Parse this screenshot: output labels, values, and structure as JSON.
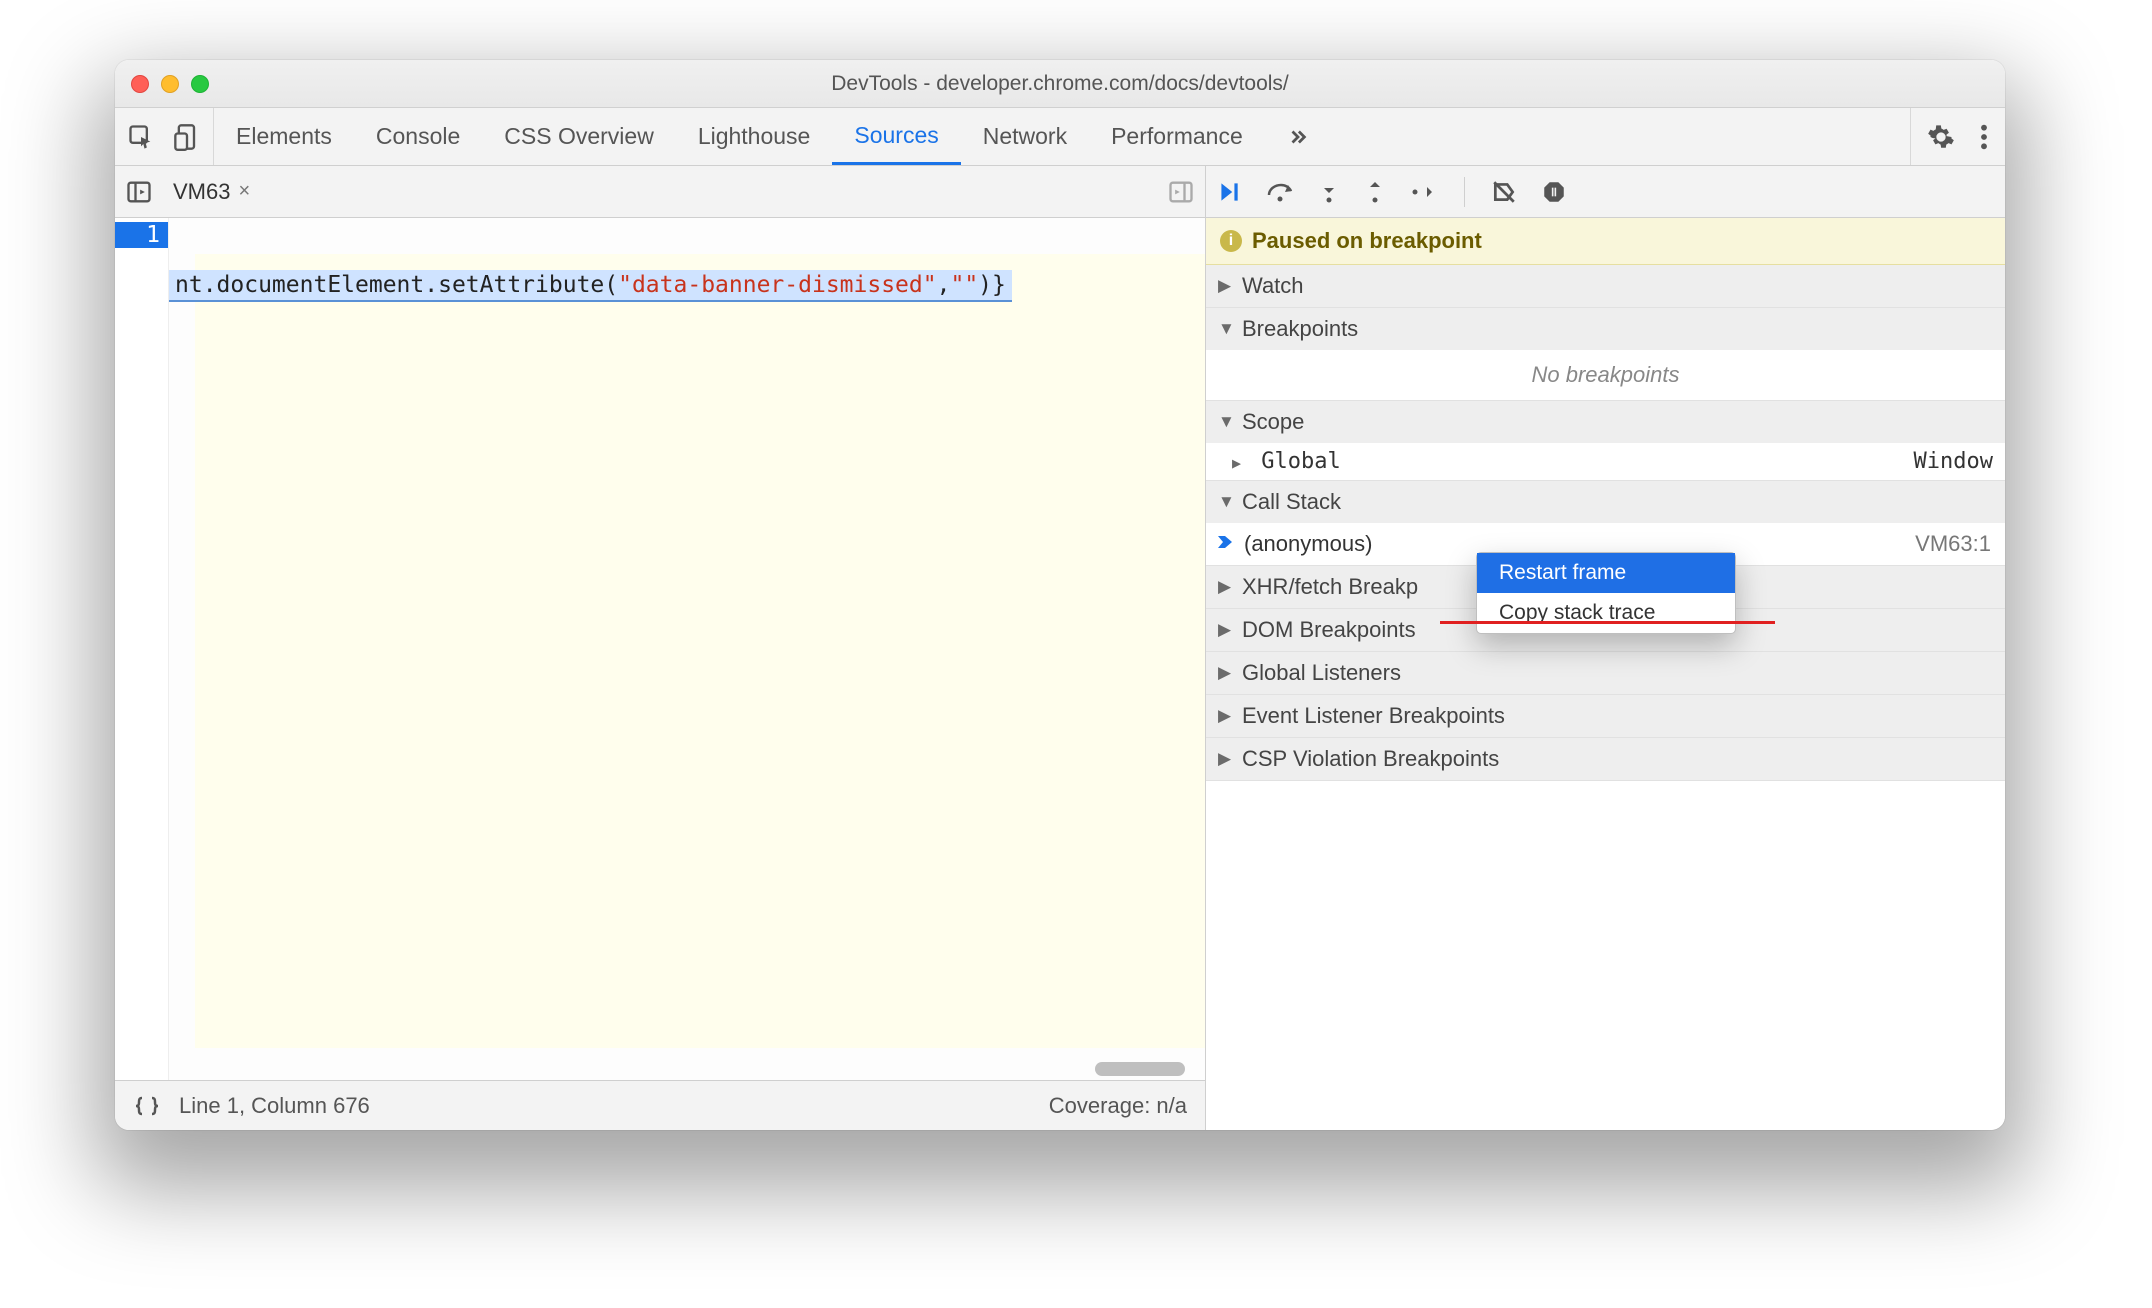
{
  "window": {
    "title": "DevTools - developer.chrome.com/docs/devtools/"
  },
  "tabs": {
    "items": [
      "Elements",
      "Console",
      "CSS Overview",
      "Lighthouse",
      "Sources",
      "Network",
      "Performance"
    ],
    "active": "Sources"
  },
  "source": {
    "file_tab": "VM63",
    "line_number": "1",
    "code_prefix": "nt.documentElement.setAttribute(",
    "code_string": "\"data-banner-dismissed\"",
    "code_mid": ",",
    "code_string2": "\"\"",
    "code_suffix": ")}"
  },
  "statusbar": {
    "position": "Line 1, Column 676",
    "coverage": "Coverage: n/a"
  },
  "debugger": {
    "paused_text": "Paused on breakpoint",
    "sections": {
      "watch": "Watch",
      "breakpoints": "Breakpoints",
      "breakpoints_empty": "No breakpoints",
      "scope": "Scope",
      "scope_global": "Global",
      "scope_global_value": "Window",
      "call_stack": "Call Stack",
      "call_stack_frame": "(anonymous)",
      "call_stack_loc": "VM63:1",
      "xhr": "XHR/fetch Breakp",
      "dom": "DOM Breakpoints",
      "global_listeners": "Global Listeners",
      "event_listeners": "Event Listener Breakpoints",
      "csp": "CSP Violation Breakpoints"
    }
  },
  "context_menu": {
    "items": [
      "Restart frame",
      "Copy stack trace"
    ],
    "hovered": "Restart frame"
  }
}
